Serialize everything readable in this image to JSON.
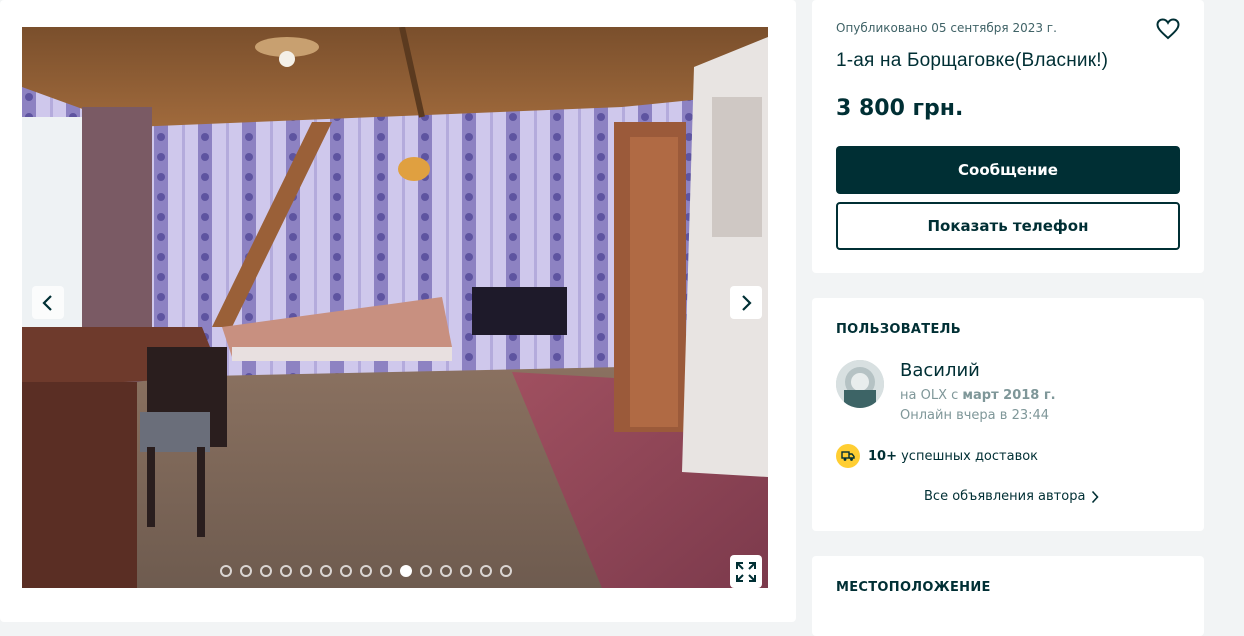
{
  "gallery": {
    "dots_total": 15,
    "active_dot": 10
  },
  "listing": {
    "published": "Опубликовано 05 сентября 2023 г.",
    "title": "1-ая на Борщаговке(Власник!)",
    "price": "3 800 грн.",
    "message_button": "Сообщение",
    "phone_button": "Показать телефон"
  },
  "user": {
    "section_title": "ПОЛЬЗОВАТЕЛЬ",
    "name": "Василий",
    "since_prefix": "на OLX с ",
    "since_date": "март 2018 г.",
    "online": "Онлайн вчера в 23:44",
    "deliveries_count": "10+",
    "deliveries_label": " успешных доставок",
    "all_ads": "Все объявления автора"
  },
  "location": {
    "section_title": "МЕСТОПОЛОЖЕНИЕ"
  },
  "colors": {
    "primary": "#002f34",
    "delivery_badge": "#ffce32",
    "background": "#f2f4f5"
  },
  "icons": [
    "chevron-left-icon",
    "chevron-right-icon",
    "expand-icon",
    "heart-icon",
    "truck-icon",
    "chevron-right-small-icon",
    "avatar-placeholder"
  ]
}
